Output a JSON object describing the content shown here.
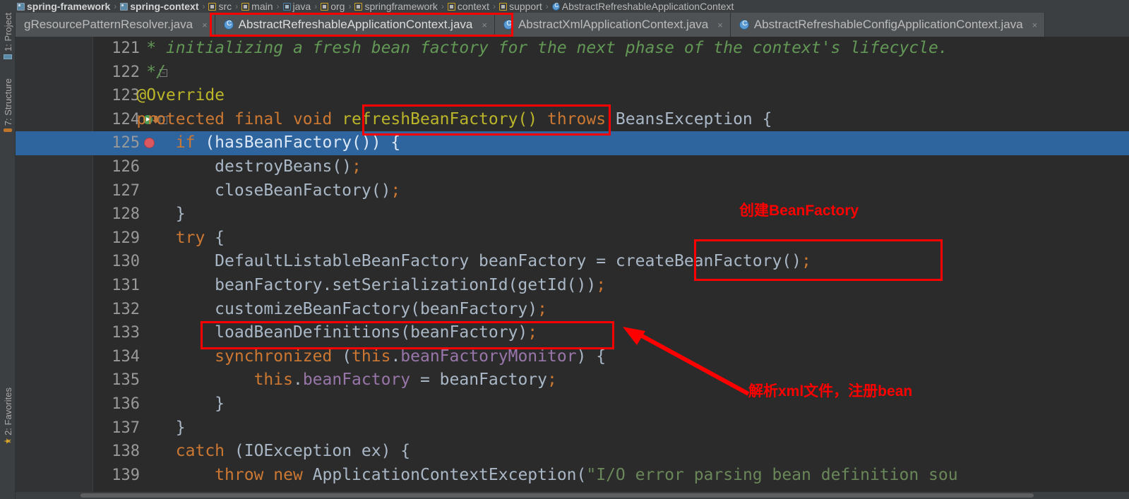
{
  "breadcrumb": {
    "items": [
      {
        "label": "spring-framework",
        "icon": "module-icon",
        "bold": true
      },
      {
        "label": "spring-context",
        "icon": "module-icon",
        "bold": true
      },
      {
        "label": "src",
        "icon": "folder-icon",
        "bold": false
      },
      {
        "label": "main",
        "icon": "folder-icon",
        "bold": false
      },
      {
        "label": "java",
        "icon": "folder-blue-icon",
        "bold": false
      },
      {
        "label": "org",
        "icon": "folder-icon",
        "bold": false
      },
      {
        "label": "springframework",
        "icon": "folder-icon",
        "bold": false
      },
      {
        "label": "context",
        "icon": "folder-icon",
        "bold": false
      },
      {
        "label": "support",
        "icon": "folder-icon",
        "bold": false
      },
      {
        "label": "AbstractRefreshableApplicationContext",
        "icon": "class-icon",
        "bold": false
      }
    ],
    "separator": "›"
  },
  "tabs": [
    {
      "label": "gResourcePatternResolver.java",
      "selected": false,
      "close": "×",
      "icon": "class-icon",
      "show_icon": false
    },
    {
      "label": "AbstractRefreshableApplicationContext.java",
      "selected": true,
      "close": "×",
      "icon": "class-icon",
      "show_icon": true
    },
    {
      "label": "AbstractXmlApplicationContext.java",
      "selected": false,
      "close": "×",
      "icon": "class-icon",
      "show_icon": true
    },
    {
      "label": "AbstractRefreshableConfigApplicationContext.java",
      "selected": false,
      "close": "×",
      "icon": "class-icon",
      "show_icon": true
    }
  ],
  "tool_windows": [
    {
      "label": "1: Project",
      "icon": "project-icon"
    },
    {
      "label": "7: Structure",
      "icon": "structure-icon"
    },
    {
      "label": "2: Favorites",
      "icon": "favorites-icon"
    }
  ],
  "editor": {
    "selected_line": 125,
    "breakpoint_line": 125,
    "run_marker_line": 124,
    "lines": [
      {
        "num": "121",
        "tokens": [
          {
            "t": "     * initializing a fresh bean factory for the next phase of the context's lifecycle.",
            "c": "cmt"
          }
        ]
      },
      {
        "num": "122",
        "tokens": [
          {
            "t": "     */",
            "c": "cmt"
          }
        ]
      },
      {
        "num": "123",
        "tokens": [
          {
            "t": "    @Override",
            "c": "ann"
          }
        ]
      },
      {
        "num": "124",
        "tokens": [
          {
            "t": "    ",
            "c": "txt"
          },
          {
            "t": "protected final void ",
            "c": "k"
          },
          {
            "t": "refreshBeanFactory() ",
            "c": "ann"
          },
          {
            "t": "throws ",
            "c": "k"
          },
          {
            "t": "BeansException {",
            "c": "txt"
          }
        ]
      },
      {
        "num": "125",
        "tokens": [
          {
            "t": "        ",
            "c": "txt"
          },
          {
            "t": "if ",
            "c": "k"
          },
          {
            "t": "(hasBeanFactory()) {",
            "c": "sel"
          }
        ]
      },
      {
        "num": "126",
        "tokens": [
          {
            "t": "            destroyBeans()",
            "c": "txt"
          },
          {
            "t": ";",
            "c": "pun"
          }
        ]
      },
      {
        "num": "127",
        "tokens": [
          {
            "t": "            closeBeanFactory()",
            "c": "txt"
          },
          {
            "t": ";",
            "c": "pun"
          }
        ]
      },
      {
        "num": "128",
        "tokens": [
          {
            "t": "        }",
            "c": "txt"
          }
        ]
      },
      {
        "num": "129",
        "tokens": [
          {
            "t": "        ",
            "c": "txt"
          },
          {
            "t": "try ",
            "c": "k"
          },
          {
            "t": "{",
            "c": "txt"
          }
        ]
      },
      {
        "num": "130",
        "tokens": [
          {
            "t": "            DefaultListableBeanFactory beanFactory = createBeanFactory()",
            "c": "txt"
          },
          {
            "t": ";",
            "c": "pun"
          }
        ]
      },
      {
        "num": "131",
        "tokens": [
          {
            "t": "            beanFactory.setSerializationId(getId())",
            "c": "txt"
          },
          {
            "t": ";",
            "c": "pun"
          }
        ]
      },
      {
        "num": "132",
        "tokens": [
          {
            "t": "            customizeBeanFactory(beanFactory)",
            "c": "txt"
          },
          {
            "t": ";",
            "c": "pun"
          }
        ]
      },
      {
        "num": "133",
        "tokens": [
          {
            "t": "            loadBeanDefinitions(beanFactory)",
            "c": "txt"
          },
          {
            "t": ";",
            "c": "pun"
          }
        ]
      },
      {
        "num": "134",
        "tokens": [
          {
            "t": "            ",
            "c": "txt"
          },
          {
            "t": "synchronized ",
            "c": "k"
          },
          {
            "t": "(",
            "c": "txt"
          },
          {
            "t": "this",
            "c": "k"
          },
          {
            "t": ".",
            "c": "txt"
          },
          {
            "t": "beanFactoryMonitor",
            "c": "fld"
          },
          {
            "t": ") {",
            "c": "txt"
          }
        ]
      },
      {
        "num": "135",
        "tokens": [
          {
            "t": "                ",
            "c": "txt"
          },
          {
            "t": "this",
            "c": "k"
          },
          {
            "t": ".",
            "c": "txt"
          },
          {
            "t": "beanFactory",
            "c": "fld"
          },
          {
            "t": " = beanFactory",
            "c": "txt"
          },
          {
            "t": ";",
            "c": "pun"
          }
        ]
      },
      {
        "num": "136",
        "tokens": [
          {
            "t": "            }",
            "c": "txt"
          }
        ]
      },
      {
        "num": "137",
        "tokens": [
          {
            "t": "        }",
            "c": "txt"
          }
        ]
      },
      {
        "num": "138",
        "tokens": [
          {
            "t": "        ",
            "c": "txt"
          },
          {
            "t": "catch ",
            "c": "k"
          },
          {
            "t": "(IOException ex) {",
            "c": "txt"
          }
        ]
      },
      {
        "num": "139",
        "tokens": [
          {
            "t": "            ",
            "c": "txt"
          },
          {
            "t": "throw new ",
            "c": "k"
          },
          {
            "t": "ApplicationContextException(",
            "c": "txt"
          },
          {
            "t": "\"I/O error parsing bean definition sou",
            "c": "str"
          }
        ]
      }
    ]
  },
  "annotations": {
    "create_bean_factory_note": "创建BeanFactory",
    "load_bean_definitions_note": "解析xml文件，注册bean",
    "accent_color": "#ff0000",
    "boxes": [
      {
        "name": "tab-highlight-box"
      },
      {
        "name": "refresh-bean-factory-box"
      },
      {
        "name": "create-bean-factory-box"
      },
      {
        "name": "load-bean-definitions-box"
      }
    ]
  }
}
